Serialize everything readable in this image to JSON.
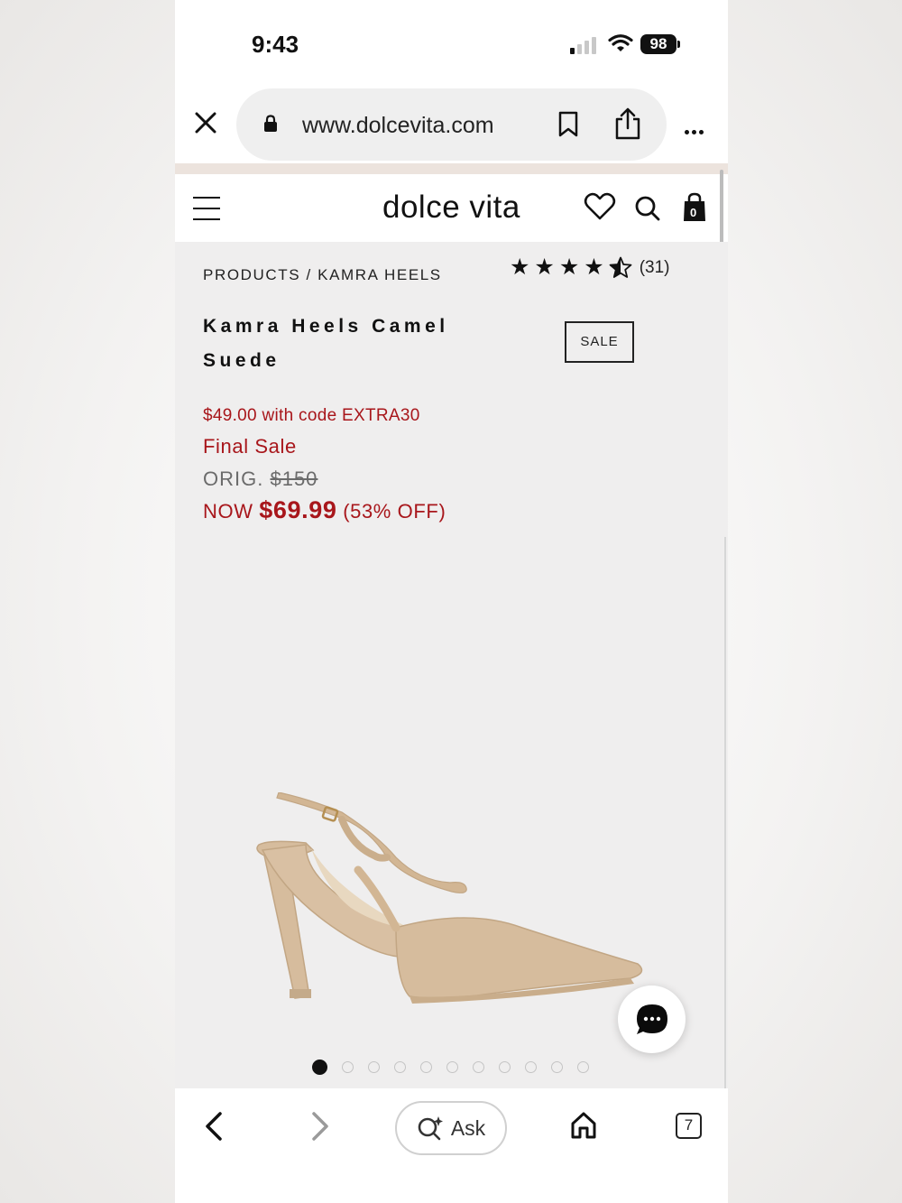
{
  "status_bar": {
    "time": "9:43",
    "battery": "98"
  },
  "browser": {
    "url": "www.dolcevita.com",
    "tab_count": "7",
    "ask_label": "Ask"
  },
  "site": {
    "logo": "dolce vita",
    "bag_count": "0"
  },
  "product": {
    "breadcrumb": "PRODUCTS / KAMRA HEELS",
    "rating": 4.5,
    "review_count": "(31)",
    "title": "Kamra Heels Camel Suede",
    "badge": "SALE",
    "promo_text": "$49.00 with code EXTRA30",
    "final_sale": "Final Sale",
    "orig_label": "ORIG.",
    "orig_price": "$150",
    "now_label": "NOW",
    "now_price": "$69.99",
    "discount": "(53% OFF)"
  },
  "gallery": {
    "image_count": 11,
    "active_index": 0
  },
  "colors": {
    "sale_red": "#a8161b",
    "suede": "#d6bc9d",
    "header_band": "#ece3dd"
  }
}
